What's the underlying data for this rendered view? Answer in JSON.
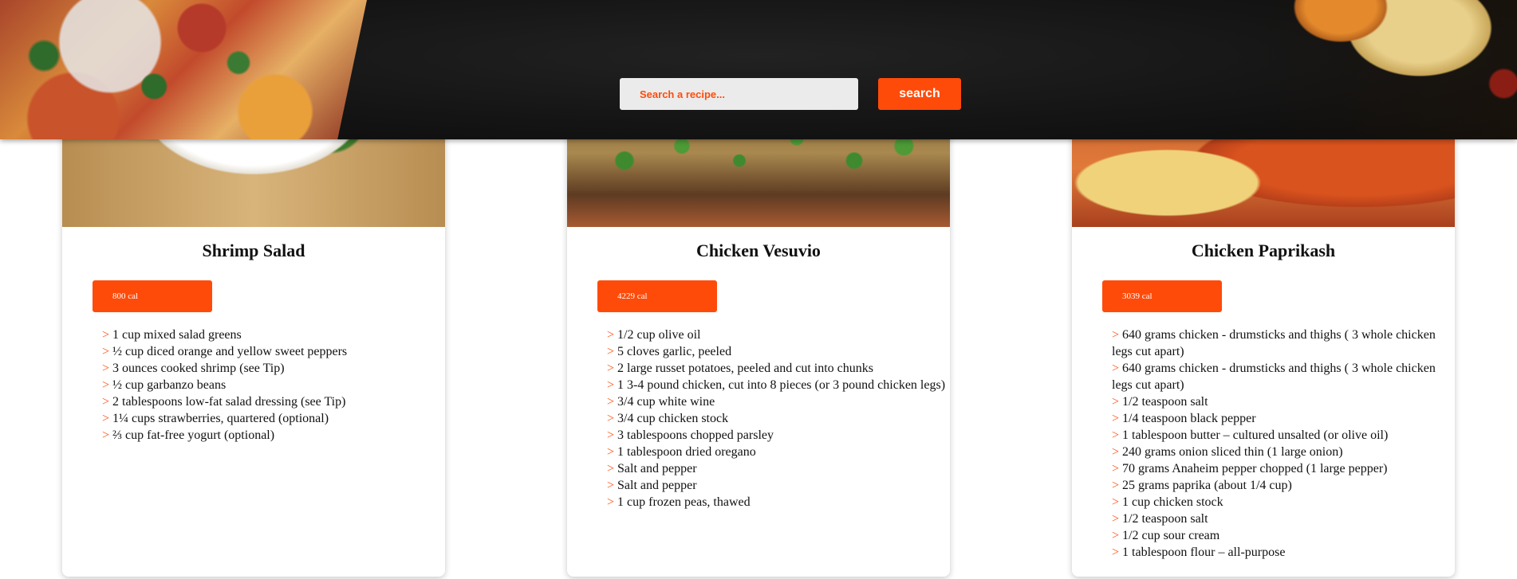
{
  "search": {
    "placeholder": "Search a recipe...",
    "button_label": "search"
  },
  "recipes": [
    {
      "title": "Shrimp Salad",
      "calories": "800 cal",
      "ingredients": [
        "1 cup mixed salad greens",
        "½ cup diced orange and yellow sweet peppers",
        "3 ounces cooked shrimp (see Tip)",
        "½ cup garbanzo beans",
        "2 tablespoons low-fat salad dressing (see Tip)",
        "1¼ cups strawberries, quartered (optional)",
        "⅔ cup fat-free yogurt (optional)"
      ]
    },
    {
      "title": "Chicken Vesuvio",
      "calories": "4229 cal",
      "ingredients": [
        "1/2 cup olive oil",
        "5 cloves garlic, peeled",
        "2 large russet potatoes, peeled and cut into chunks",
        "1 3-4 pound chicken, cut into 8 pieces (or 3 pound chicken legs)",
        "3/4 cup white wine",
        "3/4 cup chicken stock",
        "3 tablespoons chopped parsley",
        "1 tablespoon dried oregano",
        "Salt and pepper",
        "Salt and pepper",
        "1 cup frozen peas, thawed"
      ]
    },
    {
      "title": "Chicken Paprikash",
      "calories": "3039 cal",
      "ingredients": [
        "640 grams chicken - drumsticks and thighs ( 3 whole chicken legs cut apart)",
        "640 grams chicken - drumsticks and thighs ( 3 whole chicken legs cut apart)",
        "1/2 teaspoon salt",
        "1/4 teaspoon black pepper",
        "1 tablespoon butter – cultured unsalted (or olive oil)",
        "240 grams onion sliced thin (1 large onion)",
        "70 grams Anaheim pepper chopped (1 large pepper)",
        "25 grams paprika (about 1/4 cup)",
        "1 cup chicken stock",
        "1/2 teaspoon salt",
        "1/2 cup sour cream",
        "1 tablespoon flour – all-purpose"
      ]
    }
  ]
}
